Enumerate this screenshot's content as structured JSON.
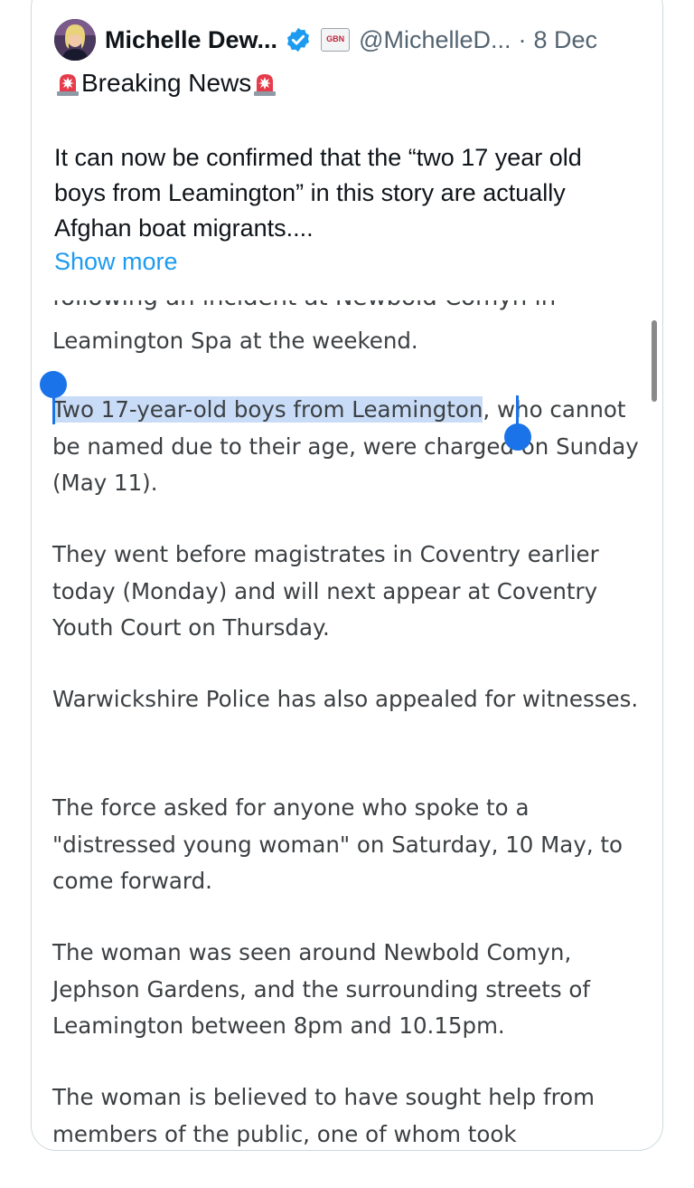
{
  "tweet": {
    "author_name": "Michelle Dew...",
    "author_handle": "@MichelleD...",
    "separator": "·",
    "date": "8 Dec",
    "affiliate_badge": "GBN",
    "heading": "Breaking News",
    "body": "It can now be confirmed that the “two 17 year old boys from Leamington” in this story are actually Afghan boat migrants....",
    "show_more": "Show more"
  },
  "article": {
    "cut_line": "following an incident at Newbold Comyn in",
    "paragraphs": [
      "Leamington Spa at the weekend.",
      "who cannot be named due to their age, were charged on Sunday (May 11).",
      "They went before magistrates in Coventry earlier today (Monday) and will next appear at Coventry Youth Court on Thursday.",
      "Warwickshire Police has also appealed for witnesses.",
      "The force asked for anyone who spoke to a \"distressed young woman\" on Saturday, 10 May, to come forward.",
      "The woman was seen around Newbold Comyn, Jephson Gardens, and the surrounding streets of Leamington between 8pm and 10.15pm.",
      "The woman is believed to have sought help from members of the public, one of whom took"
    ],
    "selected_text": "Two 17-year-old boys from Leamington"
  },
  "colors": {
    "link": "#1d9bf0",
    "verified": "#1d9bf0",
    "selection": "#c9dcf7",
    "selection_handle": "#1a73e8"
  },
  "icons": {
    "verified": "verified-badge-icon",
    "siren": "police-light-emoji",
    "affiliate": "gb-news-badge-icon"
  }
}
